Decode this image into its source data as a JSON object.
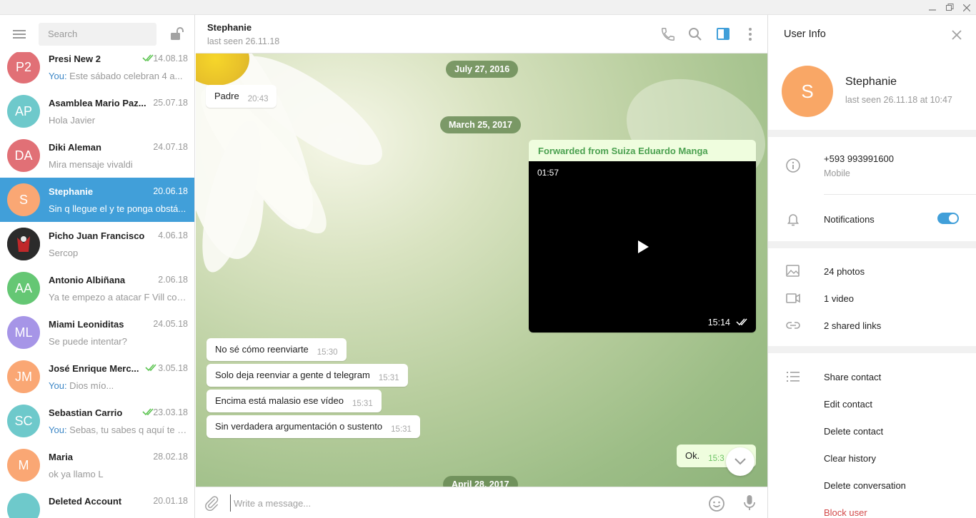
{
  "left": {
    "search_placeholder": "Search",
    "chats": [
      {
        "initials": "P2",
        "color": "#e17076",
        "name": "Presi New 2",
        "date": "14.08.18",
        "you": "You:",
        "preview": " Este sábado celebran 4 a...",
        "read": true
      },
      {
        "initials": "AP",
        "color": "#6ec9cb",
        "name": "Asamblea Mario Paz...",
        "date": "25.07.18",
        "you": "",
        "preview": "Hola Javier",
        "read": false
      },
      {
        "initials": "DA",
        "color": "#e17076",
        "name": "Diki Aleman",
        "date": "24.07.18",
        "you": "",
        "preview": "Mira mensaje vivaldi",
        "read": false
      },
      {
        "initials": "S",
        "color": "#faa774",
        "name": "Stephanie",
        "date": "20.06.18",
        "you": "",
        "preview": "Sin q llegue el y te ponga obstá...",
        "read": false,
        "active": true
      },
      {
        "initials": "",
        "color": "#3a3a3a",
        "name": "Picho Juan Francisco",
        "date": "4.06.18",
        "you": "",
        "preview": "Sercop",
        "read": false,
        "photo": true
      },
      {
        "initials": "AA",
        "color": "#65c774",
        "name": "Antonio Albiñana",
        "date": "2.06.18",
        "you": "",
        "preview": "Ya te empezo a atacar F Vill con...",
        "read": false
      },
      {
        "initials": "ML",
        "color": "#a695e7",
        "name": "Miami Leoniditas",
        "date": "24.05.18",
        "you": "",
        "preview": "Se puede intentar?",
        "read": false
      },
      {
        "initials": "JM",
        "color": "#faa774",
        "name": "José Enrique Merc...",
        "date": "3.05.18",
        "you": "You:",
        "preview": " Dios mío...",
        "read": true
      },
      {
        "initials": "SC",
        "color": "#6ec9cb",
        "name": "Sebastian Carrio",
        "date": "23.03.18",
        "you": "You:",
        "preview": " Sebas, tu sabes q aquí te q...",
        "read": true
      },
      {
        "initials": "M",
        "color": "#faa774",
        "name": "Maria",
        "date": "28.02.18",
        "you": "",
        "preview": "ok ya llamo L",
        "read": false
      },
      {
        "initials": "",
        "color": "#6ec9cb",
        "name": "Deleted Account",
        "date": "20.01.18",
        "you": "",
        "preview": "",
        "read": false
      }
    ]
  },
  "header": {
    "name": "Stephanie",
    "status": "last seen 26.11.18"
  },
  "messages": {
    "date1": "July 27, 2016",
    "date2": "March 25, 2017",
    "date3": "April 28, 2017",
    "padre_text": "Padre",
    "padre_time": "20:43",
    "fwd_label": "Forwarded from Suiza Eduardo Manga",
    "video_duration": "01:57",
    "video_time": "15:14",
    "m1_text": "No sé cómo reenviarte",
    "m1_time": "15:30",
    "m2_text": "Solo deja reenviar a gente d telegram",
    "m2_time": "15:31",
    "m3_text": "Encima está malasio ese vídeo",
    "m3_time": "15:31",
    "m4_text": "Sin verdadera argumentación o sustento",
    "m4_time": "15:31",
    "ok_text": "Ok.",
    "ok_time": "15:3"
  },
  "composer": {
    "placeholder": "Write a message..."
  },
  "right": {
    "title": "User Info",
    "avatar_initials": "S",
    "name": "Stephanie",
    "last_seen": "last seen 26.11.18 at 10:47",
    "phone": "+593 993991600",
    "phone_label": "Mobile",
    "notifications": "Notifications",
    "notifications_on": true,
    "photos": "24 photos",
    "videos": "1 video",
    "links": "2 shared links",
    "actions": {
      "share": "Share contact",
      "edit": "Edit contact",
      "delete": "Delete contact",
      "clear": "Clear history",
      "delete_conv": "Delete conversation",
      "block": "Block user"
    }
  },
  "colors": {
    "accent": "#419fd9",
    "outgoing": "#effdde",
    "read_tick": "#5dc452",
    "danger": "#d24949"
  }
}
